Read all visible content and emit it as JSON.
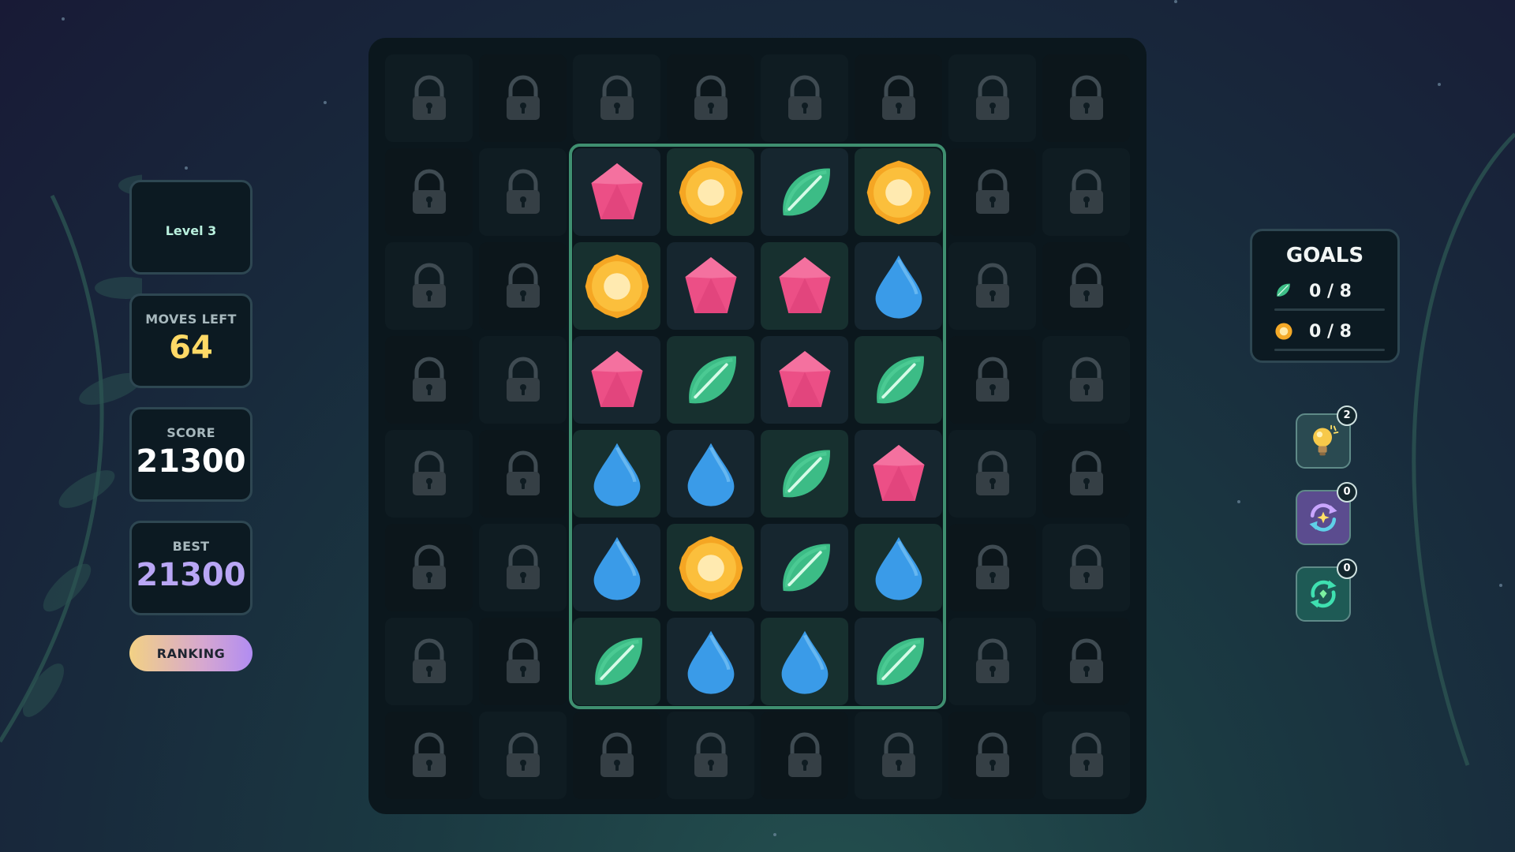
{
  "stats": {
    "level": "Level 3",
    "moves_label": "MOVES LEFT",
    "moves_value": "64",
    "score_label": "SCORE",
    "score_value": "21300",
    "best_label": "BEST",
    "best_value": "21300",
    "ranking_label": "RANKING"
  },
  "colors": {
    "moves": "#ffd966",
    "score": "#ffffff",
    "best": "#b9a6f5",
    "frame": "#3f8f70"
  },
  "goals": {
    "title": "GOALS",
    "items": [
      {
        "icon": "leaf-gem-icon",
        "text": "0 / 8"
      },
      {
        "icon": "coin-gem-icon",
        "text": "0 / 8"
      }
    ]
  },
  "boosters": [
    {
      "name": "hint-bulb-booster",
      "icon": "lightbulb-icon",
      "count": "2"
    },
    {
      "name": "swap-booster",
      "icon": "swap-arrows-icon",
      "count": "0"
    },
    {
      "name": "shuffle-booster",
      "icon": "refresh-icon",
      "count": "0"
    }
  ],
  "board": {
    "cols": 8,
    "rows": 8,
    "cells": [
      [
        "lock",
        "lock",
        "lock",
        "lock",
        "lock",
        "lock",
        "lock",
        "lock"
      ],
      [
        "lock",
        "lock",
        "gem",
        "coin",
        "leaf",
        "coin",
        "lock",
        "lock"
      ],
      [
        "lock",
        "lock",
        "coin",
        "gem",
        "gem",
        "drop",
        "lock",
        "lock"
      ],
      [
        "lock",
        "lock",
        "gem",
        "leaf",
        "gem",
        "leaf",
        "lock",
        "lock"
      ],
      [
        "lock",
        "lock",
        "drop",
        "drop",
        "leaf",
        "gem",
        "lock",
        "lock"
      ],
      [
        "lock",
        "lock",
        "drop",
        "coin",
        "leaf",
        "drop",
        "lock",
        "lock"
      ],
      [
        "lock",
        "lock",
        "leaf",
        "drop",
        "drop",
        "leaf",
        "lock",
        "lock"
      ],
      [
        "lock",
        "lock",
        "lock",
        "lock",
        "lock",
        "lock",
        "lock",
        "lock"
      ]
    ]
  }
}
